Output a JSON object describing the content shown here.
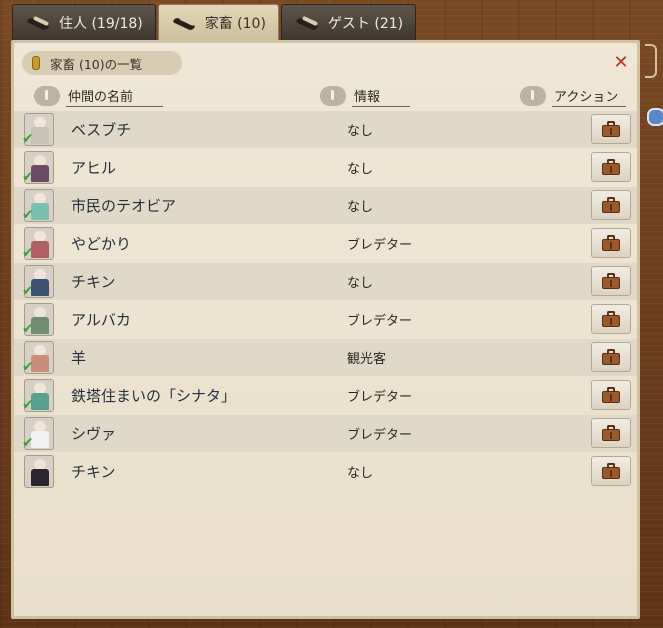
{
  "tabs": [
    {
      "label": "住人 (19/18)",
      "active": false,
      "icon": "sandal-icon"
    },
    {
      "label": "家畜 (10)",
      "active": true,
      "icon": "sandal-icon"
    },
    {
      "label": "ゲスト (21)",
      "active": false,
      "icon": "sandal-icon"
    }
  ],
  "panel": {
    "title": "家畜 (10)の一覧",
    "close_label": "✕"
  },
  "columns": {
    "name": "仲間の名前",
    "info": "情報",
    "action": "アクション"
  },
  "rows": [
    {
      "name": "ベスブチ",
      "info": "なし",
      "checked": true,
      "color": "#c7c1b4"
    },
    {
      "name": "アヒル",
      "info": "なし",
      "checked": true,
      "color": "#6b4a64"
    },
    {
      "name": "市民のテオビア",
      "info": "なし",
      "checked": true,
      "color": "#7cc1b0"
    },
    {
      "name": "やどかり",
      "info": "ブレデター",
      "checked": true,
      "color": "#b06060"
    },
    {
      "name": "チキン",
      "info": "なし",
      "checked": true,
      "color": "#3c5270"
    },
    {
      "name": "アルバカ",
      "info": "ブレデター",
      "checked": true,
      "color": "#6e8e6e"
    },
    {
      "name": "羊",
      "info": "観光客",
      "checked": true,
      "color": "#c98e7a"
    },
    {
      "name": "鉄塔住まいの「シナタ」",
      "info": "ブレデター",
      "checked": true,
      "color": "#5aa08e"
    },
    {
      "name": "シヴァ",
      "info": "ブレデター",
      "checked": true,
      "color": "#f2f2f2"
    },
    {
      "name": "チキン",
      "info": "なし",
      "checked": false,
      "color": "#2b2530"
    }
  ]
}
